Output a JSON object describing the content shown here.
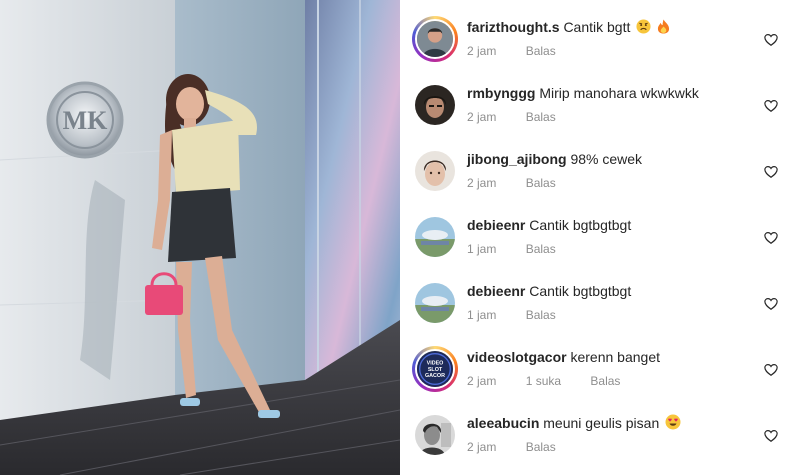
{
  "post": {
    "photo_alt": "woman posing in front of MK store wall"
  },
  "comments": [
    {
      "username": "farizthought.s",
      "text": "Cantik bgtt",
      "emojis": [
        "sad-face-icon",
        "fire-icon"
      ],
      "time": "2 jam",
      "likes": "",
      "reply_label": "Balas",
      "has_story_ring": true,
      "avatar_icon": "person-avatar"
    },
    {
      "username": "rmbynggg",
      "text": "Mirip manohara wkwkwkk",
      "emojis": [],
      "time": "2 jam",
      "likes": "",
      "reply_label": "Balas",
      "has_story_ring": false,
      "avatar_icon": "person-avatar"
    },
    {
      "username": "jibong_ajibong",
      "text": "98% cewek",
      "emojis": [],
      "time": "2 jam",
      "likes": "",
      "reply_label": "Balas",
      "has_story_ring": false,
      "avatar_icon": "person-avatar"
    },
    {
      "username": "debieenr",
      "text": "Cantik bgtbgtbgt",
      "emojis": [],
      "time": "1 jam",
      "likes": "",
      "reply_label": "Balas",
      "has_story_ring": false,
      "avatar_icon": "landscape-avatar"
    },
    {
      "username": "debieenr",
      "text": "Cantik bgtbgtbgt",
      "emojis": [],
      "time": "1 jam",
      "likes": "",
      "reply_label": "Balas",
      "has_story_ring": false,
      "avatar_icon": "landscape-avatar"
    },
    {
      "username": "videoslotgacor",
      "text": "kerenn banget",
      "emojis": [],
      "time": "2 jam",
      "likes": "1 suka",
      "reply_label": "Balas",
      "has_story_ring": true,
      "avatar_icon": "logo-avatar",
      "avatar_text": [
        "VIDEO",
        "SLOT",
        "GACOR"
      ]
    },
    {
      "username": "aleeabucin",
      "text": "meuni geulis pisan",
      "emojis": [
        "heart-eyes-icon"
      ],
      "time": "2 jam",
      "likes": "",
      "reply_label": "Balas",
      "has_story_ring": false,
      "avatar_icon": "bw-photo-avatar"
    }
  ],
  "colors": {
    "username": "#262626",
    "meta": "#8e8e8e",
    "heart_stroke": "#262626"
  }
}
